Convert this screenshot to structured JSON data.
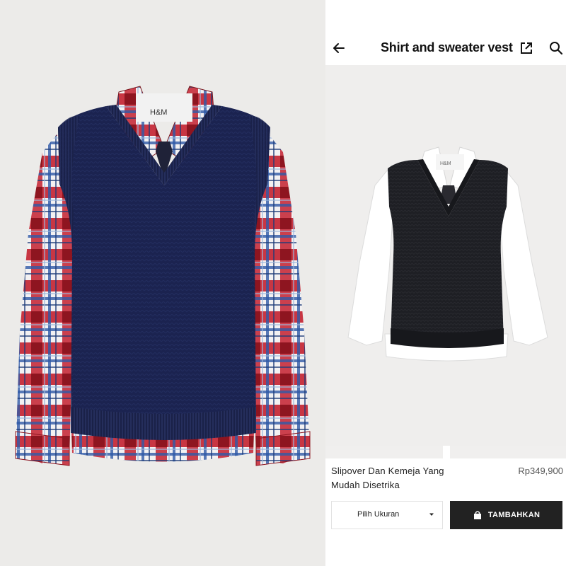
{
  "header": {
    "title": "Shirt and sweater vest"
  },
  "left_photo": {
    "brand_tag": "H&M",
    "vest_color": "#1b2350",
    "shirt_pattern": "red-white-blue plaid"
  },
  "product_photo": {
    "brand_tag": "H&M",
    "vest_color": "#1e1f24",
    "shirt_color": "#ffffff"
  },
  "product": {
    "name": "Slipover Dan Kemeja Yang Mudah Disetrika",
    "price": "Rp349,900"
  },
  "actions": {
    "size_placeholder": "Pilih Ukuran",
    "add_label": "TAMBAHKAN"
  },
  "icons": {
    "back": "back-arrow-icon",
    "external": "external-link-icon",
    "search": "search-icon",
    "caret": "caret-down-icon",
    "bag": "shopping-bag-icon"
  },
  "colors": {
    "button_bg": "#222222",
    "button_text": "#ffffff",
    "page_bg": "#ffffff"
  }
}
